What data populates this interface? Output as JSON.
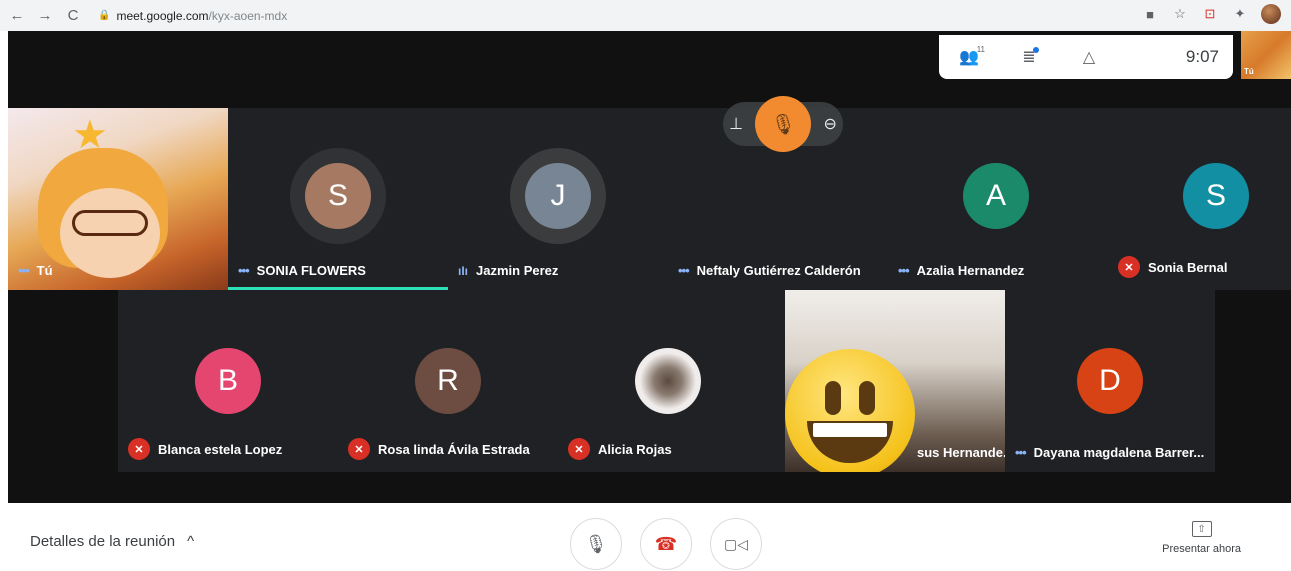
{
  "browser": {
    "back": "←",
    "forward": "→",
    "reload": "C",
    "lock": "🔒",
    "url_host": "meet.google.com",
    "url_path": "/kyx-aoen-mdx",
    "icons": [
      "camera-icon",
      "star-icon",
      "extension-icon",
      "puzzle-icon",
      "profile-avatar"
    ],
    "cam": "■",
    "star": "☆",
    "ext": "⊡",
    "puzzle": "✦"
  },
  "top_panel": {
    "people_icon": "👥",
    "people_count": "11",
    "chat_icon": "≣",
    "activities_icon": "△",
    "clock": "9:07",
    "self_label": "Tú"
  },
  "participants_row1": [
    {
      "name": "Tú",
      "indicator": "•••"
    },
    {
      "name": "SONIA FLOWERS",
      "initial": "S",
      "color": "#a67a62",
      "indicator": "•••"
    },
    {
      "name": "Jazmin Perez",
      "initial": "J",
      "color": "#788595",
      "indicator": "ıIı"
    },
    {
      "name": "Neftaly Gutiérrez Calderón",
      "indicator": "•••"
    },
    {
      "name": "Azalia Hernandez",
      "initial": "A",
      "color": "#1b8a6b",
      "indicator": "•••"
    },
    {
      "name": "Sonia Bernal",
      "initial": "S",
      "color": "#138fa3",
      "indicator": "mute"
    }
  ],
  "participants_row2": [
    {
      "name": "Blanca estela Lopez",
      "initial": "B",
      "color": "#e5466f",
      "indicator": "mute"
    },
    {
      "name": "Rosa linda Ávila Estrada",
      "initial": "R",
      "color": "#6d4c41",
      "indicator": "mute"
    },
    {
      "name": "Alicia Rojas",
      "indicator": "mute"
    },
    {
      "name": "sus Hernande...",
      "indicator": "mute"
    },
    {
      "name": "Dayana magdalena Barrer...",
      "initial": "D",
      "color": "#d84315",
      "indicator": "•••"
    }
  ],
  "pin_controls": {
    "pin": "⊥",
    "mic": "🎙",
    "remove": "⊖"
  },
  "bottom": {
    "details_label": "Detalles de la reunión",
    "chevron": "^",
    "mic": "🎙",
    "hangup": "☎",
    "camera": "▢◁",
    "present_label": "Presentar ahora",
    "present_icon": "⇧"
  },
  "colors": {
    "accent": "#2ee0b8",
    "mute": "#d93025",
    "stage": "#202124"
  }
}
